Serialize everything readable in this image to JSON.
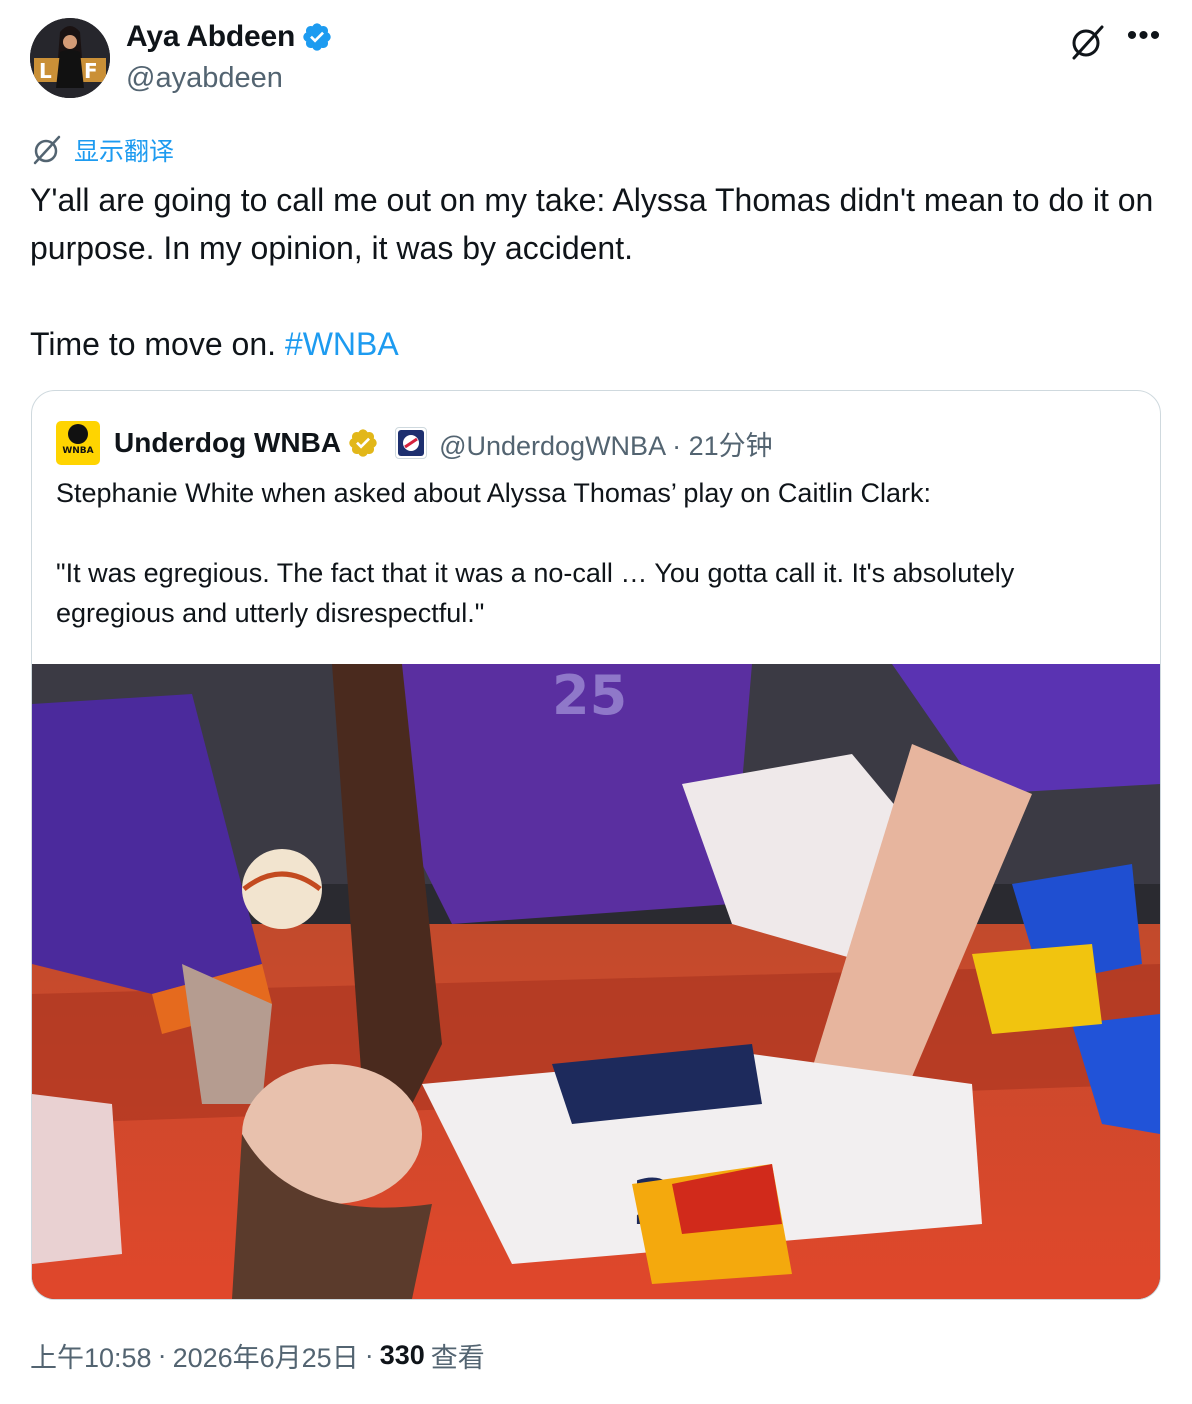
{
  "author": {
    "name": "Aya Abdeen",
    "handle": "@ayabdeen"
  },
  "translate_label": "显示翻译",
  "tweet": {
    "body": "Y'all are going to call me out on my take: Alyssa Thomas didn't mean to do it on purpose. In my opinion, it was by accident.\n\nTime to move on. ",
    "hashtag": "#WNBA"
  },
  "quoted_tweet": {
    "logo_text": "WNBA",
    "name": "Underdog WNBA",
    "handle_time": "@UnderdogWNBA · 21分钟",
    "text": "Stephanie White when asked about Alyssa Thomas’ play on Caitlin Clark:\n\n\"It was egregious. The fact that it was a no-call … You gotta call it. It's absolutely egregious and utterly disrespectful.\""
  },
  "meta": {
    "time": "上午10:58",
    "date": "2026年6月25日",
    "views_count": "330",
    "views_label": "查看"
  },
  "colors": {
    "accent": "#1d9bf0",
    "text": "#0f1419",
    "secondary": "#536471",
    "border": "#cfd9de",
    "gold_badge": "#e2b719"
  }
}
